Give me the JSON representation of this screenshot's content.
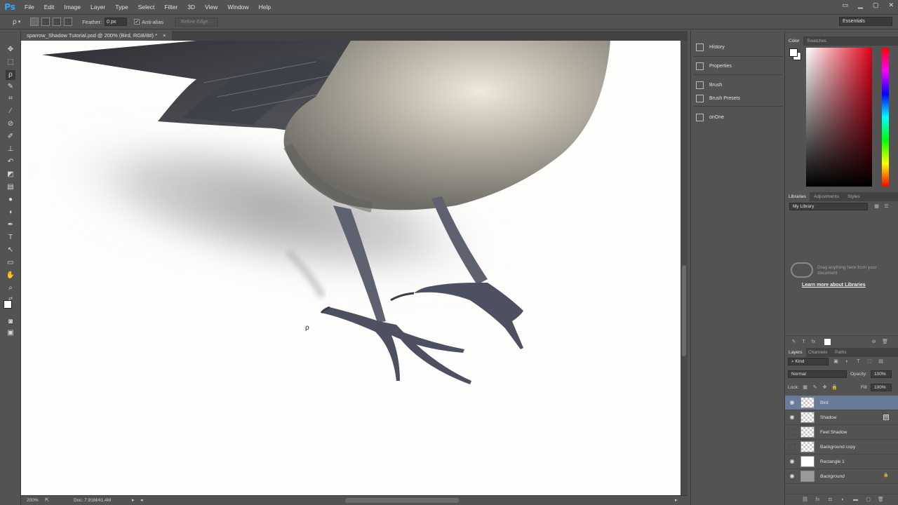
{
  "app": {
    "logo": "Ps"
  },
  "menu": [
    "File",
    "Edit",
    "Image",
    "Layer",
    "Type",
    "Select",
    "Filter",
    "3D",
    "View",
    "Window",
    "Help"
  ],
  "options_bar": {
    "feather_label": "Feather:",
    "feather_value": "0 px",
    "antialias_label": "Anti-alias",
    "antialias_checked": true,
    "refine_edge": "Refine Edge...",
    "workspace": "Essentials"
  },
  "document": {
    "tab_title": "sparrow_Shadow Tutorial.psd @ 200% (Bird, RGB/8#) *",
    "close": "×",
    "zoom": "200%",
    "doc_info": "Doc: 7.91M/41.4M"
  },
  "mid_panel": {
    "items": [
      "History",
      "Properties",
      "Brush",
      "Brush Presets",
      "onOne"
    ]
  },
  "color_panel": {
    "tabs": [
      "Color",
      "Swatches"
    ],
    "foreground": "#ffffff",
    "background": "#ffffff",
    "hue_color": "#e00018"
  },
  "libraries_panel": {
    "tabs": [
      "Libraries",
      "Adjustments",
      "Styles"
    ],
    "library": "My Library",
    "message": "Drag anything here from your document",
    "link": "Learn more about Libraries"
  },
  "layers_panel": {
    "tabs": [
      "Layers",
      "Channels",
      "Paths"
    ],
    "filter": "Kind",
    "blend_mode": "Normal",
    "opacity_label": "Opacity:",
    "opacity": "100%",
    "lock_label": "Lock:",
    "fill_label": "Fill:",
    "fill": "100%",
    "layers": [
      {
        "name": "Bird",
        "visible": true,
        "selected": true
      },
      {
        "name": "Shadow",
        "visible": true,
        "selected": false
      },
      {
        "name": "Feet Shadow",
        "visible": false,
        "selected": false
      },
      {
        "name": "Background copy",
        "visible": false,
        "selected": false
      },
      {
        "name": "Rectangle 1",
        "visible": true,
        "selected": false
      },
      {
        "name": "Background",
        "visible": true,
        "selected": false
      }
    ]
  },
  "colors": {
    "ui_bg": "#535353",
    "canvas_bg": "#fdfdfc",
    "selected_layer": "#687c99"
  }
}
